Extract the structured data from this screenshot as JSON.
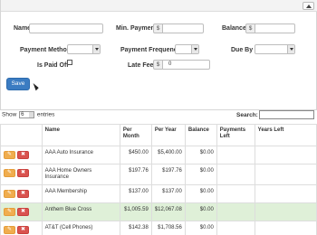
{
  "form": {
    "name_label": "Name",
    "min_payment_label": "Min. Payment",
    "min_payment_prefix": "$",
    "balance_label": "Balance",
    "balance_prefix": "$",
    "payment_method_label": "Payment Method",
    "payment_frequency_label": "Payment Frequency",
    "due_by_label": "Due By",
    "is_paid_off_label": "Is Paid Off",
    "late_fee_label": "Late Fee",
    "late_fee_prefix": "$",
    "late_fee_value": "0",
    "save_label": "Save"
  },
  "table_controls": {
    "show_prefix": "Show",
    "show_value": "6",
    "show_suffix": "entries",
    "search_label": "Search:"
  },
  "columns": [
    "",
    "Name",
    "Per Month",
    "Per Year",
    "Balance",
    "Payments Left",
    "Years Left"
  ],
  "rows": [
    {
      "name": "AAA Auto Insurance",
      "per_month": "$450.00",
      "per_year": "$5,400.00",
      "balance": "$0.00",
      "payments_left": "",
      "years_left": ""
    },
    {
      "name": "AAA Home Owners Insurance",
      "per_month": "$197.76",
      "per_year": "$197.76",
      "balance": "$0.00",
      "payments_left": "",
      "years_left": ""
    },
    {
      "name": "AAA Membership",
      "per_month": "$137.00",
      "per_year": "$137.00",
      "balance": "$0.00",
      "payments_left": "",
      "years_left": ""
    },
    {
      "name": "Anthem Blue Cross",
      "per_month": "$1,005.59",
      "per_year": "$12,067.08",
      "balance": "$0.00",
      "payments_left": "",
      "years_left": ""
    },
    {
      "name": "AT&T (Cell Phones)",
      "per_month": "$142.38",
      "per_year": "$1,708.56",
      "balance": "$0.00",
      "payments_left": "",
      "years_left": ""
    }
  ],
  "row_actions": {
    "edit_glyph": "✎",
    "delete_glyph": "✖"
  },
  "icons": {
    "collapse": "chevron-up-icon",
    "edit": "pencil-icon",
    "delete": "close-icon"
  },
  "colors": {
    "primary": "#3b7cc2",
    "warning": "#f0ad4e",
    "danger": "#d9534f",
    "highlight_row": "#dff0d8"
  }
}
